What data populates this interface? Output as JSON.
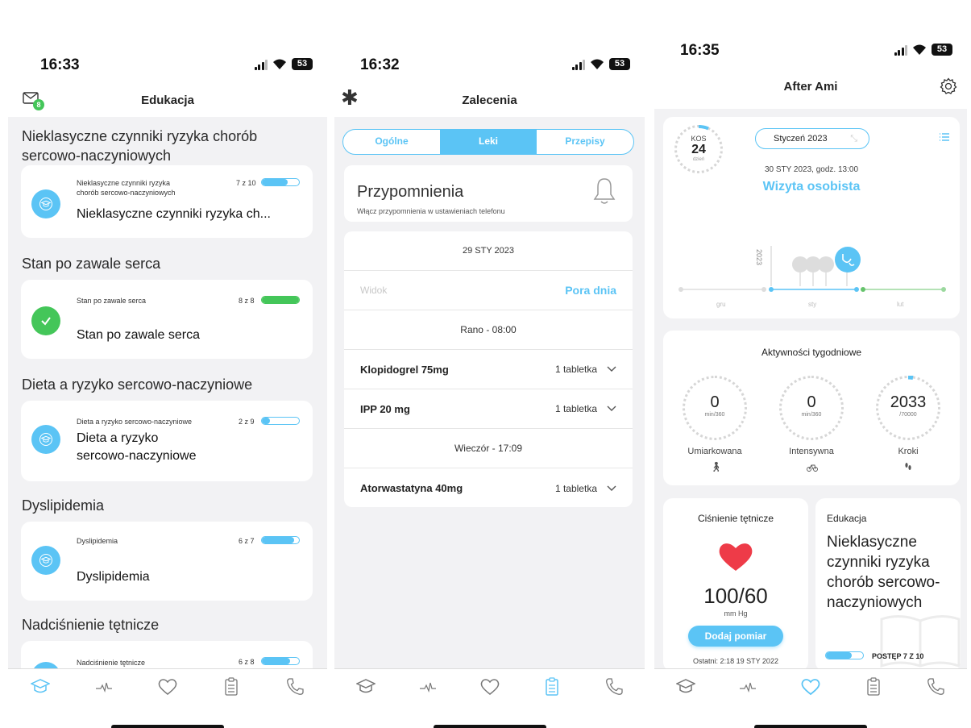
{
  "phone1": {
    "status": {
      "time": "16:33",
      "battery": "53"
    },
    "header": {
      "title": "Edukacja",
      "badge": "8"
    },
    "sections": [
      {
        "title_l1": "Nieklasyczne czynniki ryzyka chorób",
        "title_l2": "sercowo-naczyniowych",
        "small_l1": "Nieklasyczne czynniki ryzyka",
        "small_l2": "chorób sercowo-naczyniowych",
        "count": "7 z 10",
        "progress": 0.7,
        "big_l1": "Nieklasyczne czynniki ryzyka ch...",
        "big_l2": "",
        "done": false
      },
      {
        "title_l1": "Stan po zawale serca",
        "title_l2": "",
        "small_l1": "Stan po zawale serca",
        "small_l2": "",
        "count": "8 z 8",
        "progress": 1.0,
        "big_l1": "Stan po zawale serca",
        "big_l2": "",
        "done": true
      },
      {
        "title_l1": "Dieta a ryzyko sercowo-naczyniowe",
        "title_l2": "",
        "small_l1": "Dieta a ryzyko sercowo-naczyniowe",
        "small_l2": "",
        "count": "2 z 9",
        "progress": 0.22,
        "big_l1": "Dieta a ryzyko",
        "big_l2": "sercowo-naczyniowe",
        "done": false
      },
      {
        "title_l1": "Dyslipidemia",
        "title_l2": "",
        "small_l1": "Dyslipidemia",
        "small_l2": "",
        "count": "6 z 7",
        "progress": 0.86,
        "big_l1": "Dyslipidemia",
        "big_l2": "",
        "done": false
      },
      {
        "title_l1": "Nadciśnienie tętnicze",
        "title_l2": "",
        "small_l1": "Nadciśnienie tętnicze",
        "small_l2": "",
        "count": "6 z 8",
        "progress": 0.75,
        "big_l1": "",
        "big_l2": "",
        "done": false
      }
    ]
  },
  "phone2": {
    "status": {
      "time": "16:32",
      "battery": "53"
    },
    "header": {
      "title": "Zalecenia"
    },
    "segments": [
      "Ogólne",
      "Leki",
      "Przepisy"
    ],
    "reminder": {
      "title": "Przypomnienia",
      "subtitle": "Włącz przypomnienia w ustawieniach telefonu"
    },
    "date": "29 STY 2023",
    "view_label": "Widok",
    "view_value": "Pora dnia",
    "morning": "Rano - 08:00",
    "evening": "Wieczór - 17:09",
    "meds": [
      {
        "name": "Klopidogrel 75mg",
        "dose": "1 tabletka"
      },
      {
        "name": "IPP 20 mg",
        "dose": "1 tabletka"
      },
      {
        "name": "Atorwastatyna 40mg",
        "dose": "1 tabletka"
      }
    ]
  },
  "phone3": {
    "status": {
      "time": "16:35",
      "battery": "53"
    },
    "header": {
      "title": "After Ami"
    },
    "kos": {
      "label": "KOS",
      "value": "24",
      "unit": "dzień"
    },
    "month": "Styczeń 2023",
    "visit_date": "30 STY 2023, godz. 13:00",
    "visit_title": "Wizyta osobista",
    "timeline": {
      "year": "2023",
      "months": [
        "gru",
        "sty",
        "lut"
      ]
    },
    "weekly": {
      "title": "Aktywności tygodniowe",
      "items": [
        {
          "value": "0",
          "unit": "min/360",
          "label": "Umiarkowana",
          "progress": 0.0
        },
        {
          "value": "0",
          "unit": "min/360",
          "label": "Intensywna",
          "progress": 0.0
        },
        {
          "value": "2033",
          "unit": "/70000",
          "label": "Kroki",
          "progress": 0.03
        }
      ]
    },
    "bp": {
      "title": "Ciśnienie tętnicze",
      "value": "100/60",
      "unit": "mm Hg",
      "button": "Dodaj pomiar",
      "last": "Ostatni: 2:18 19 STY 2022"
    },
    "edu": {
      "title": "Edukacja",
      "l1": "Nieklasyczne",
      "l2": "czynniki ryzyka",
      "l3": "chorób sercowo-",
      "l4": "naczyniowych",
      "progress_label": "POSTĘP 7 Z 10",
      "progress": 0.7
    }
  },
  "colors": {
    "accent": "#5bc4f5",
    "success": "#44c659",
    "heart": "#ee3b48"
  }
}
